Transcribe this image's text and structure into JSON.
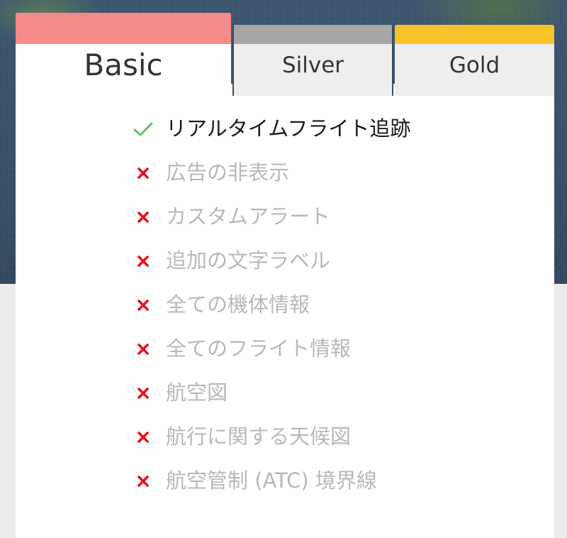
{
  "tabs": [
    {
      "label": "Basic",
      "color": "#f58a8a",
      "selected": true
    },
    {
      "label": "Silver",
      "color": "#a6a6a8",
      "selected": false
    },
    {
      "label": "Gold",
      "color": "#f8c22c",
      "selected": false
    }
  ],
  "features": [
    {
      "label": "リアルタイムフライト追跡",
      "included": true,
      "icon": "check-icon"
    },
    {
      "label": "広告の非表示",
      "included": false,
      "icon": "cross-icon"
    },
    {
      "label": "カスタムアラート",
      "included": false,
      "icon": "cross-icon"
    },
    {
      "label": "追加の文字ラベル",
      "included": false,
      "icon": "cross-icon"
    },
    {
      "label": "全ての機体情報",
      "included": false,
      "icon": "cross-icon"
    },
    {
      "label": "全てのフライト情報",
      "included": false,
      "icon": "cross-icon"
    },
    {
      "label": "航空図",
      "included": false,
      "icon": "cross-icon"
    },
    {
      "label": "航行に関する天候図",
      "included": false,
      "icon": "cross-icon"
    },
    {
      "label": "航空管制 (ATC) 境界線",
      "included": false,
      "icon": "cross-icon"
    }
  ],
  "colors": {
    "check": "#6cc070",
    "cross": "#e8101e",
    "included_text": "#1a1a1a",
    "excluded_text": "#b8b8b8"
  }
}
